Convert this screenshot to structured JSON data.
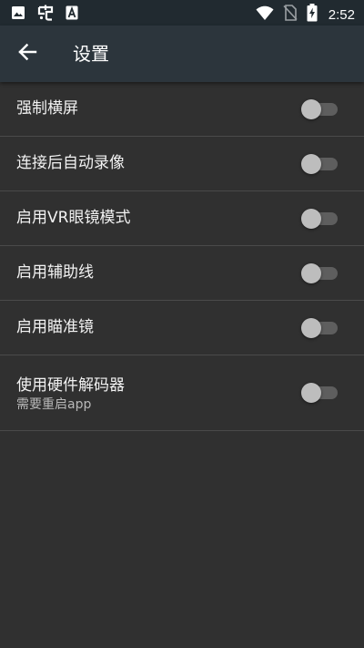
{
  "status_bar": {
    "time": "2:52",
    "left_icons": [
      "image-icon",
      "bug-icon",
      "font-a-icon"
    ],
    "right_icons": [
      "wifi-icon",
      "no-sim-icon",
      "battery-charging-icon"
    ]
  },
  "app_bar": {
    "back_icon": "arrow-left-icon",
    "title": "设置"
  },
  "settings": [
    {
      "label": "强制横屏",
      "subtitle": "",
      "enabled": false
    },
    {
      "label": "连接后自动录像",
      "subtitle": "",
      "enabled": false
    },
    {
      "label": "启用VR眼镜模式",
      "subtitle": "",
      "enabled": false
    },
    {
      "label": "启用辅助线",
      "subtitle": "",
      "enabled": false
    },
    {
      "label": "启用瞄准镜",
      "subtitle": "",
      "enabled": false
    },
    {
      "label": "使用硬件解码器",
      "subtitle": "需要重启app",
      "enabled": false
    }
  ],
  "colors": {
    "background": "#303030",
    "app_bar": "#2c353c",
    "status_bar": "#212a30",
    "toggle_track_off": "#5e5e5e",
    "toggle_thumb_off": "#bdbdbd",
    "divider": "#4a4a4a"
  }
}
